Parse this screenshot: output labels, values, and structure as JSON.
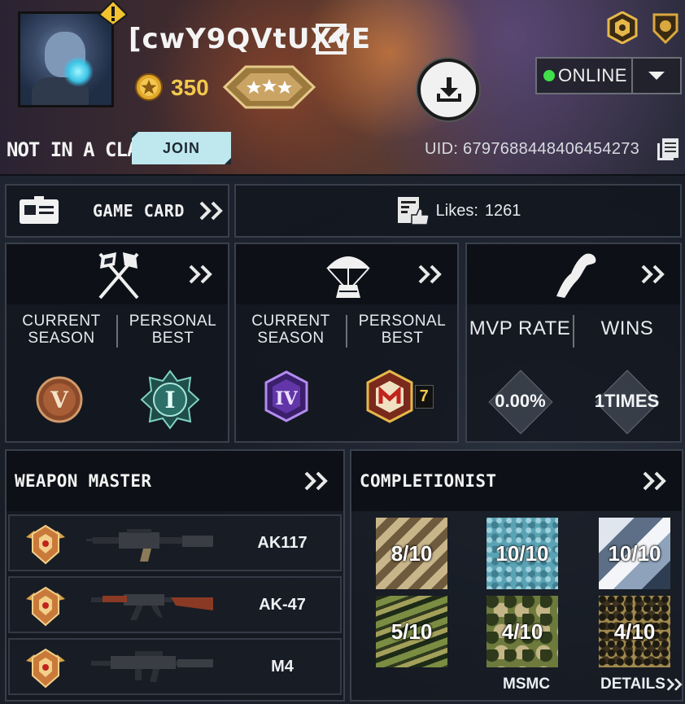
{
  "profile": {
    "name": "[cwY9QVtUXvE",
    "coins": "350",
    "status": "ONLINE",
    "clan_status": "NOT IN A CLAN",
    "join_label": "JOIN",
    "uid": "UID: 6797688448406454273"
  },
  "icons": {
    "warning": "warning-icon",
    "edit": "edit-icon",
    "coin": "coin-icon",
    "download": "download-icon",
    "copy": "copy-icon"
  },
  "game_card": {
    "label": "GAME CARD"
  },
  "likes": {
    "label": "Likes:",
    "count": "1261"
  },
  "mp_panel": {
    "col1": "CURRENT\nSEASON",
    "col1_l1": "CURRENT",
    "col1_l2": "SEASON",
    "col2_l1": "PERSONAL",
    "col2_l2": "BEST",
    "current_rank": "V",
    "best_rank": "I"
  },
  "br_panel": {
    "col1_l1": "CURRENT",
    "col1_l2": "SEASON",
    "col2_l1": "PERSONAL",
    "col2_l2": "BEST",
    "current_rank": "IV",
    "best_rank_count": "7"
  },
  "mvp_panel": {
    "col1": "MVP RATE",
    "col2": "WINS",
    "mvp_value": "0.00%",
    "wins_value": "1TIMES"
  },
  "weapon_master": {
    "title": "WEAPON MASTER",
    "rows": [
      {
        "name": "AK117"
      },
      {
        "name": "AK-47"
      },
      {
        "name": "M4"
      }
    ]
  },
  "completionist": {
    "title": "COMPLETIONIST",
    "tiles": [
      "8/10",
      "10/10",
      "10/10",
      "5/10",
      "4/10",
      "4/10"
    ],
    "msmc_label": "MSMC",
    "details_label": "DETAILS"
  },
  "colors": {
    "online": "#3fe04a",
    "coins": "#f2c94c",
    "join_bg": "#bfe7ee"
  }
}
